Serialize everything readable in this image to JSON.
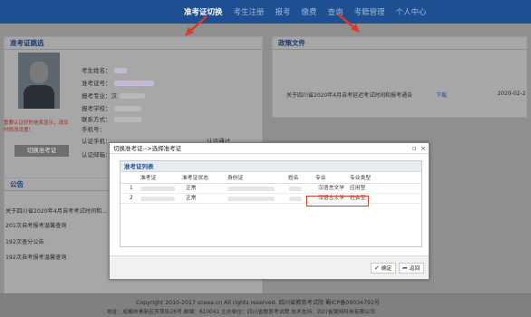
{
  "nav": {
    "items": [
      {
        "label": "准考证切换",
        "active": true
      },
      {
        "label": "考生注册",
        "active": false
      },
      {
        "label": "报考",
        "active": false
      },
      {
        "label": "缴费",
        "active": false
      },
      {
        "label": "查询",
        "active": false
      },
      {
        "label": "考籍管理",
        "active": false
      },
      {
        "label": "个人中心",
        "active": false
      }
    ]
  },
  "left_panel": {
    "title": "准考证跳选",
    "info_labels": [
      "考生姓名：",
      "准考证号：",
      "报考专业：汉",
      "报考学校：",
      "联系方式：",
      "手机号："
    ],
    "auth_label": "认证手机：",
    "auth_status": "认证通过",
    "email_label": "认证邮箱：",
    "warning": "重要认证好的信息显示，请及时修改设置！",
    "switch_button": "切换准考证"
  },
  "right_panel": {
    "title": "政策文件",
    "file": {
      "title": "关于四川省2020年4月自考延迟考试时间和报考通告",
      "download": "下载",
      "date": "2020-02-2"
    }
  },
  "notice_panel": {
    "title": "公告",
    "items": [
      "关于四川省2020年4月自考考试时间和...",
      "201次自考报考温馨查询",
      "192次查分公告",
      "192次自考报考温馨查询"
    ]
  },
  "footer": {
    "line1": "Copyright 2010-2017 sceea.cn All rights reserved. 四川省教育考试院 蜀ICP备09034792号",
    "line2": "地址：成都市青新区芳草街26号 邮编：610041 主办单位：四川省教育考试院 技术支持：四川省强网科技有限公司"
  },
  "modal": {
    "title": "切换准考证-->选择准考证",
    "list_title": "准考证列表",
    "columns": [
      "准考证",
      "准考证状态",
      "身份证",
      "姓名",
      "专业",
      "专业类型"
    ],
    "rows": [
      {
        "index": "1",
        "status": "正常",
        "major": "汉语言文学",
        "type": "应用型"
      },
      {
        "index": "2",
        "status": "正常",
        "major": "汉语言文学",
        "type": "社会型"
      }
    ],
    "confirm": "确定",
    "back": "返回"
  },
  "colors": {
    "nav_bg": "#1f4f93",
    "highlight": "#d93a2b"
  }
}
